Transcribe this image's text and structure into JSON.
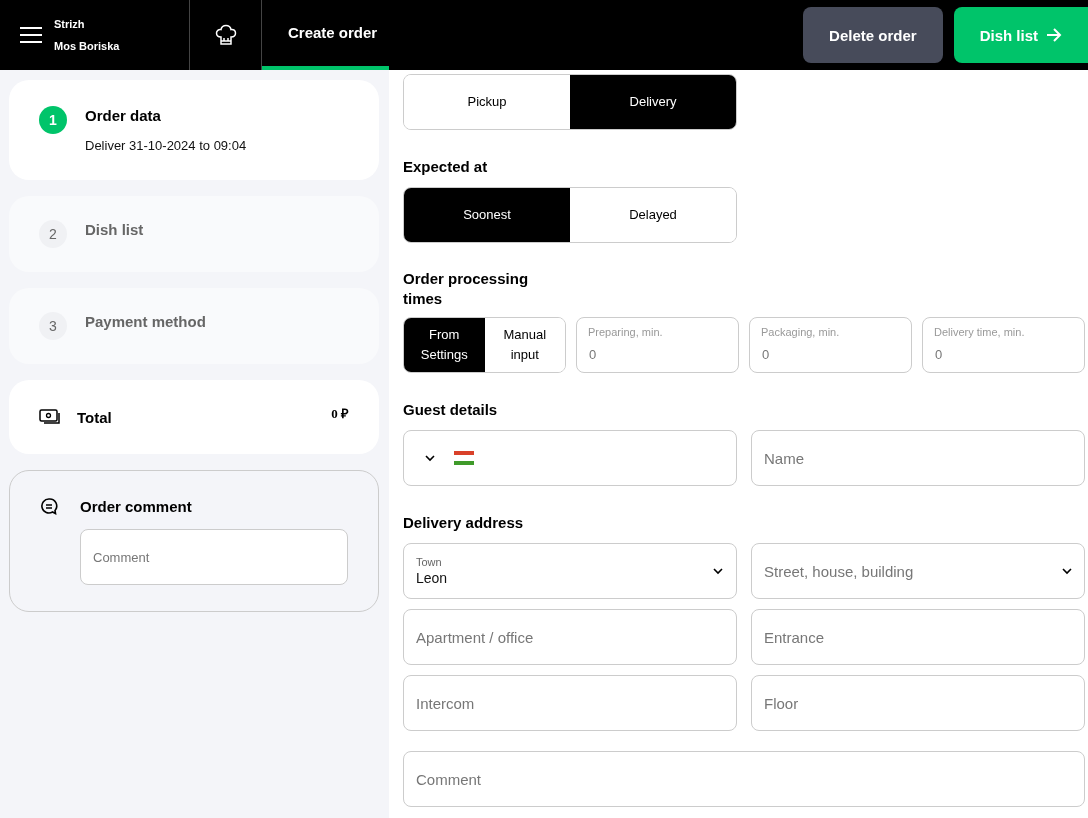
{
  "header": {
    "company": "Strizh",
    "location": "Mos Boriska",
    "tabs": [
      {
        "label": "Create order",
        "selected": true
      }
    ],
    "buttons": [
      {
        "label": "Delete order",
        "kind": "secondary"
      },
      {
        "label": "Dish list",
        "kind": "primary"
      }
    ]
  },
  "steps": [
    {
      "number": "1",
      "title": "Order data",
      "subtitle": "Deliver 31-10-2024 to 09:04",
      "selected": true
    },
    {
      "number": "2",
      "title": "Dish list",
      "selected": false
    },
    {
      "number": "3",
      "title": "Payment method",
      "selected": false
    }
  ],
  "total": {
    "label": "Total",
    "value": "0 ₽"
  },
  "order_comment": {
    "title": "Order comment",
    "placeholder": "Comment"
  },
  "order_type": [
    {
      "label": "Pickup",
      "selected": false
    },
    {
      "label": "Delivery",
      "selected": true
    }
  ],
  "expected_at": {
    "title": "Expected at",
    "options": [
      {
        "label": "Soonest",
        "selected": true
      },
      {
        "label": "Delayed",
        "selected": false
      }
    ]
  },
  "processing": {
    "title": "Order processing times",
    "options": [
      {
        "label": "From Settings",
        "selected": true
      },
      {
        "label": "Manual input",
        "selected": false
      }
    ],
    "fields": [
      {
        "label": "Preparing, min.",
        "placeholder": "0"
      },
      {
        "label": "Packaging, min.",
        "placeholder": "0"
      },
      {
        "label": "Delivery time, min.",
        "placeholder": "0"
      }
    ]
  },
  "guest": {
    "title": "Guest details",
    "name_placeholder": "Name"
  },
  "address": {
    "title": "Delivery address",
    "fields": [
      {
        "kind": "select",
        "label": "Town",
        "value": "Leon"
      },
      {
        "kind": "select",
        "placeholder": "Street, house, building"
      },
      {
        "kind": "text",
        "placeholder": "Apartment / office"
      },
      {
        "kind": "text",
        "placeholder": "Entrance"
      },
      {
        "kind": "text",
        "placeholder": "Intercom"
      },
      {
        "kind": "text",
        "placeholder": "Floor"
      },
      {
        "kind": "wide",
        "placeholder": "Comment"
      }
    ]
  }
}
